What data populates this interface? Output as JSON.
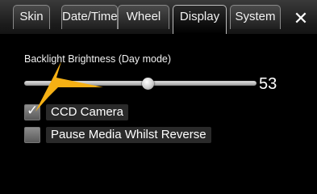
{
  "tabs": [
    {
      "label": "Skin"
    },
    {
      "label": "Date/Time"
    },
    {
      "label": "Wheel"
    },
    {
      "label": "Display",
      "active": true
    },
    {
      "label": "System"
    }
  ],
  "close": {
    "glyph": "✕"
  },
  "display": {
    "backlight": {
      "label": "Backlight Brightness (Day mode)",
      "value": "53",
      "max": 100,
      "level": 53
    },
    "options": [
      {
        "label": "CCD Camera",
        "checked": true
      },
      {
        "label": "Pause Media Whilst Reverse",
        "checked": false
      }
    ]
  },
  "annotation": {
    "arrow_color": "#f5b014",
    "icon": "pointer-arrow-icon"
  }
}
